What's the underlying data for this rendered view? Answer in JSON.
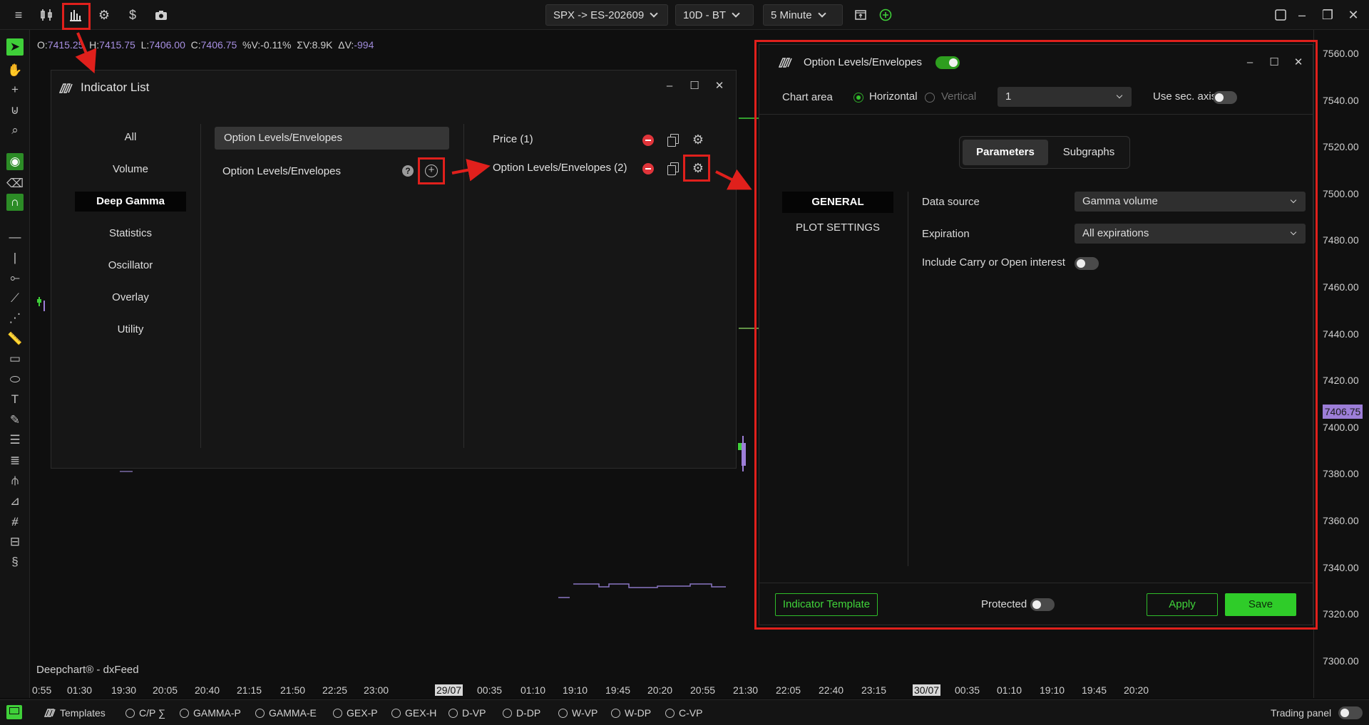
{
  "topbar": {
    "symbol": "SPX -> ES-202609",
    "range": "10D - BT",
    "timeframe": "5 Minute",
    "icons": [
      "menu-icon",
      "candles-icon",
      "indicators-icon",
      "gear-icon",
      "dollar-icon",
      "camera-icon"
    ]
  },
  "ohlc": {
    "o_label": "O:",
    "o": "7415.25",
    "h_label": "H:",
    "h": "7415.75",
    "l_label": "L:",
    "l": "7406.00",
    "c_label": "C:",
    "c": "7406.75",
    "pv_label": "%V:",
    "pv": "-0.11%",
    "sv_label": "ΣV:",
    "sv": "8.9K",
    "dv_label": "ΔV:",
    "dv": "-994"
  },
  "yaxis": {
    "ticks": [
      "7560.00",
      "7540.00",
      "7520.00",
      "7500.00",
      "7480.00",
      "7460.00",
      "7440.00",
      "7420.00",
      "7400.00",
      "7380.00",
      "7360.00",
      "7340.00",
      "7320.00",
      "7300.00"
    ],
    "current_price": "7406.75"
  },
  "xaxis": {
    "ticks": [
      "0:55",
      "01:30",
      "19:30",
      "20:05",
      "20:40",
      "21:15",
      "21:50",
      "22:25",
      "23:00",
      "29/07",
      "00:35",
      "01:10",
      "19:10",
      "19:45",
      "20:20",
      "20:55",
      "21:30",
      "22:05",
      "22:40",
      "23:15",
      "30/07",
      "00:35",
      "01:10",
      "19:10",
      "19:45",
      "20:20"
    ],
    "highlight": [
      "29/07",
      "30/07"
    ]
  },
  "brand": "Deepchart® - dxFeed",
  "bottombar": {
    "templates": "Templates",
    "items": [
      "C/P ∑",
      "GAMMA-P",
      "GAMMA-E",
      "GEX-P",
      "GEX-H",
      "D-VP",
      "D-DP",
      "W-VP",
      "W-DP",
      "C-VP"
    ],
    "trading_panel": "Trading panel"
  },
  "indicator_list": {
    "title": "Indicator List",
    "categories": [
      "All",
      "Volume",
      "Deep Gamma",
      "Statistics",
      "Oscillator",
      "Overlay",
      "Utility"
    ],
    "selected_category": "Deep Gamma",
    "search_value": "Option Levels/Envelopes",
    "available": [
      {
        "label": "Option Levels/Envelopes"
      }
    ],
    "active": [
      {
        "label": "Price (1)"
      },
      {
        "label": "Option Levels/Envelopes (2)"
      }
    ]
  },
  "settings": {
    "title": "Option Levels/Envelopes",
    "enabled": true,
    "chart_area_label": "Chart area",
    "horizontal": "Horizontal",
    "vertical": "Vertical",
    "area_value": "1",
    "sec_axis_label": "Use sec. axis",
    "tabs": [
      "Parameters",
      "Subgraphs"
    ],
    "sections": [
      "GENERAL",
      "PLOT SETTINGS"
    ],
    "data_source_label": "Data source",
    "data_source_value": "Gamma volume",
    "expiration_label": "Expiration",
    "expiration_value": "All expirations",
    "carry_label": "Include Carry or Open interest",
    "template_button": "Indicator Template",
    "protected_label": "Protected",
    "apply_button": "Apply",
    "save_button": "Save"
  },
  "colors": {
    "accent_green": "#2fcc29",
    "annotation_red": "#e0201c",
    "price_badge": "#9d7ed8"
  }
}
